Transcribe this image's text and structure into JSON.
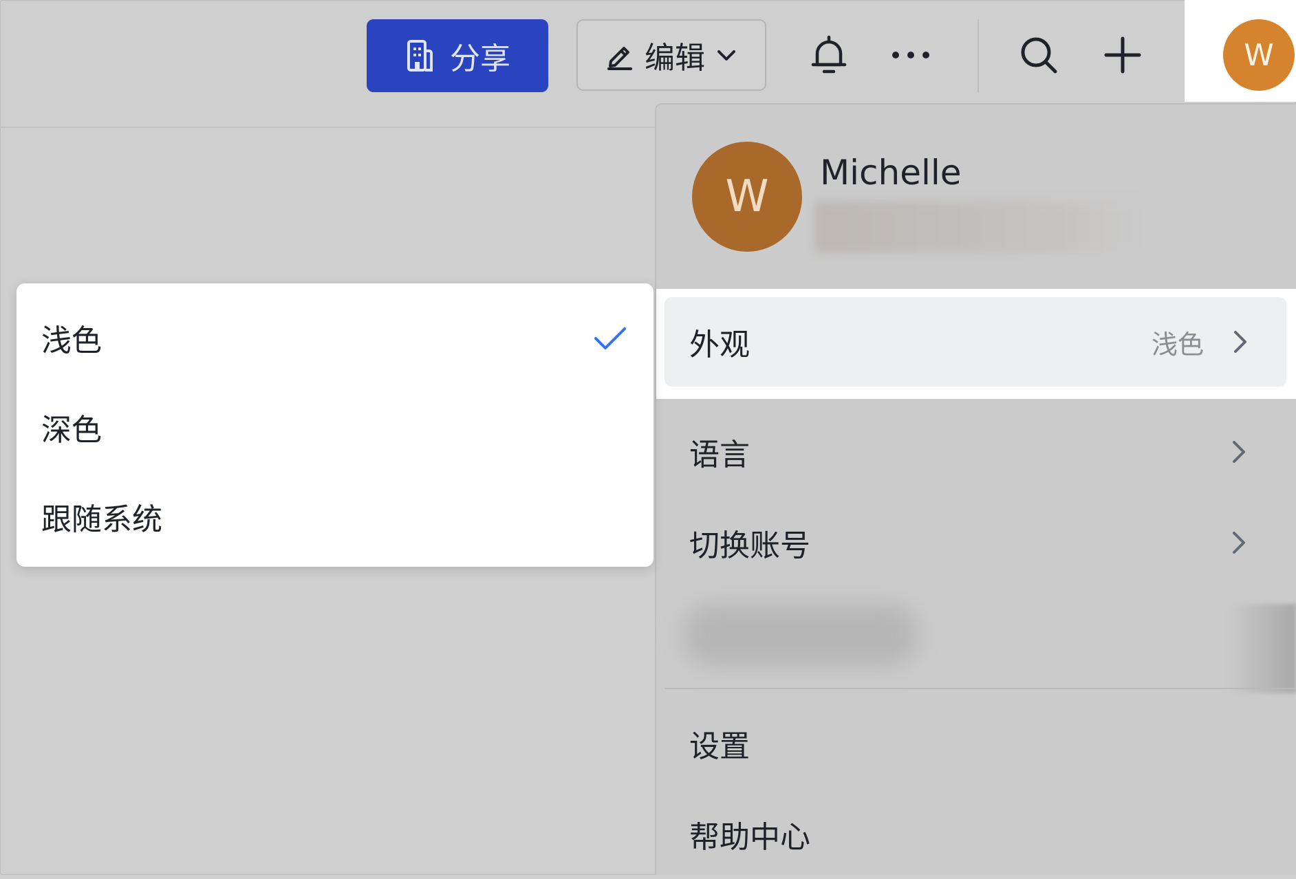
{
  "toolbar": {
    "share_label": "分享",
    "edit_label": "编辑",
    "icons": [
      "building-icon",
      "pencil-icon",
      "chevron-down-icon",
      "bell-icon",
      "more-icon",
      "search-icon",
      "plus-icon"
    ]
  },
  "user": {
    "avatar_initial": "W",
    "name": "Michelle",
    "avatar_color": "#d6832e"
  },
  "user_menu": {
    "items": [
      {
        "label": "外观",
        "value": "浅色"
      },
      {
        "label": "语言"
      },
      {
        "label": "切换账号"
      },
      {
        "label": "设置"
      },
      {
        "label": "帮助中心"
      }
    ]
  },
  "appearance_menu": {
    "options": [
      {
        "label": "浅色",
        "selected": true
      },
      {
        "label": "深色",
        "selected": false
      },
      {
        "label": "跟随系统",
        "selected": false
      }
    ],
    "check_color": "#3370ff"
  },
  "colors": {
    "share_button": "#2a43be",
    "overlay": "#cfcfcf"
  }
}
